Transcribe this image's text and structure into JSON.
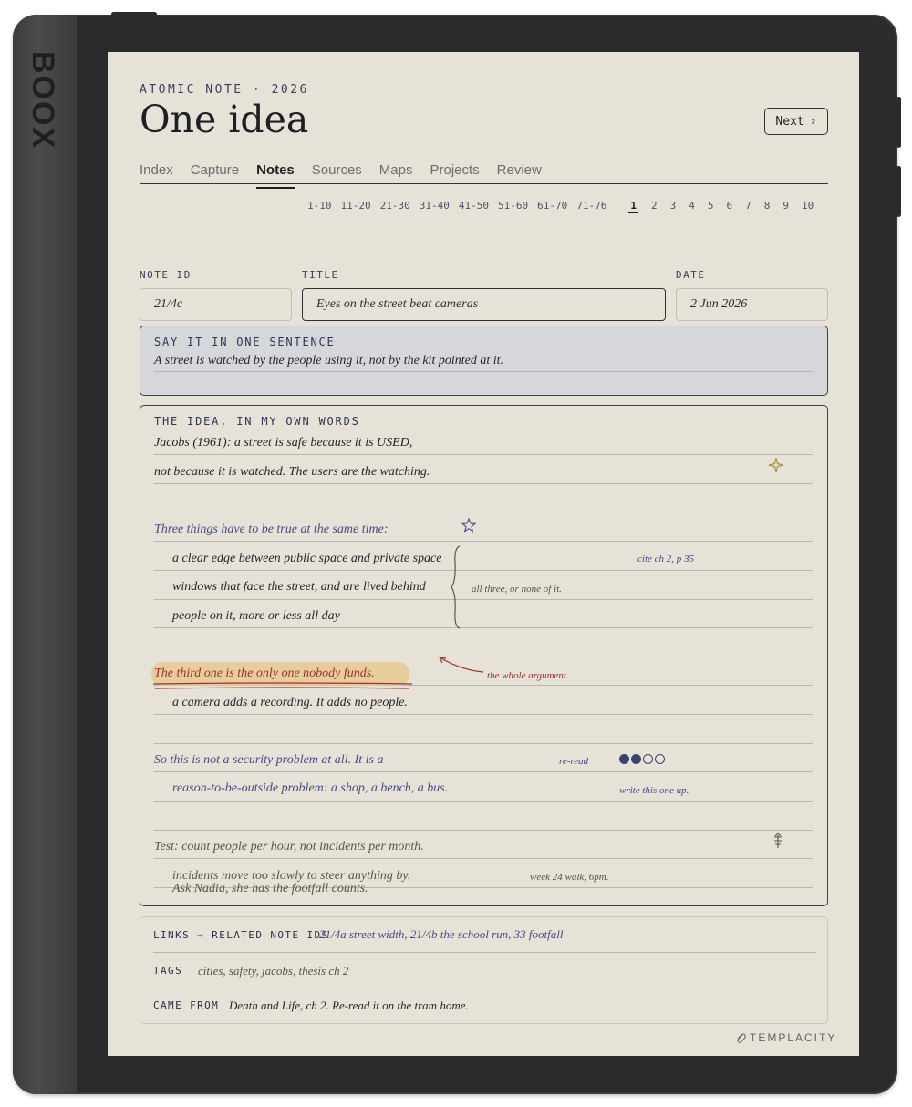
{
  "device": {
    "brand": "BOOX"
  },
  "header": {
    "kicker": "ATOMIC NOTE · 2026",
    "title": "One idea",
    "next_label": "Next",
    "next_icon": "chevron-right-icon"
  },
  "tabs": [
    {
      "label": "Index",
      "active": false
    },
    {
      "label": "Capture",
      "active": false
    },
    {
      "label": "Notes",
      "active": true
    },
    {
      "label": "Sources",
      "active": false
    },
    {
      "label": "Maps",
      "active": false
    },
    {
      "label": "Projects",
      "active": false
    },
    {
      "label": "Review",
      "active": false
    }
  ],
  "pager": {
    "ranges": [
      "1-10",
      "11-20",
      "21-30",
      "31-40",
      "41-50",
      "51-60",
      "61-70",
      "71-76"
    ],
    "pages": [
      "1",
      "2",
      "3",
      "4",
      "5",
      "6",
      "7",
      "8",
      "9",
      "10"
    ],
    "current": "1"
  },
  "fields": {
    "note_id": {
      "label": "NOTE ID",
      "value": "21/4c"
    },
    "title": {
      "label": "TITLE",
      "value": "Eyes on the street beat cameras"
    },
    "date": {
      "label": "DATE",
      "value": "2 Jun 2026"
    }
  },
  "sentence": {
    "label": "SAY IT IN ONE SENTENCE",
    "text": "A street is watched by the people using it, not by the kit pointed at it."
  },
  "idea": {
    "label": "THE IDEA, IN MY OWN WORDS",
    "lines": [
      "Jacobs (1961): a street is safe because it is USED,",
      "not because it is watched. The users are the watching.",
      "Three things have to be true at the same time:",
      "a clear edge between public space and private space",
      "windows that face the street, and are lived behind",
      "people on it, more or less all day",
      "The third one is the only one nobody funds.",
      "a camera adds a recording. It adds no people.",
      "So this is not a security problem at all. It is a",
      "reason-to-be-outside problem: a shop, a bench, a bus.",
      "Test: count people per hour, not incidents per month.",
      "incidents move too slowly to steer anything by.",
      "Ask Nadia, she has the footfall counts."
    ],
    "notes": {
      "cite": "cite ch 2, p 35",
      "all_three": "all three, or none of it.",
      "whole_argument": "the whole argument.",
      "reread": "re-read",
      "write_up": "write this one up.",
      "week": "week 24 walk, 6pm."
    },
    "reread_progress": "2 of 4",
    "icons": [
      "sparkle-icon",
      "star-icon",
      "arrow-icon",
      "bracket-icon",
      "leaf-icon"
    ],
    "colors": {
      "blue_ink": "#474a86",
      "red_ink": "#a22f2f",
      "highlight": "#e6c990"
    }
  },
  "links": {
    "related_label": "LINKS → RELATED NOTE IDS",
    "related_value": "21/4a street width, 21/4b the school run, 33 footfall",
    "tags_label": "TAGS",
    "tags_value": "cities, safety, jacobs, thesis ch 2",
    "came_from_label": "CAME FROM",
    "came_from_value": "Death and Life, ch 2. Re-read it on the tram home."
  },
  "footer": {
    "brand": "TEMPLACITY"
  }
}
